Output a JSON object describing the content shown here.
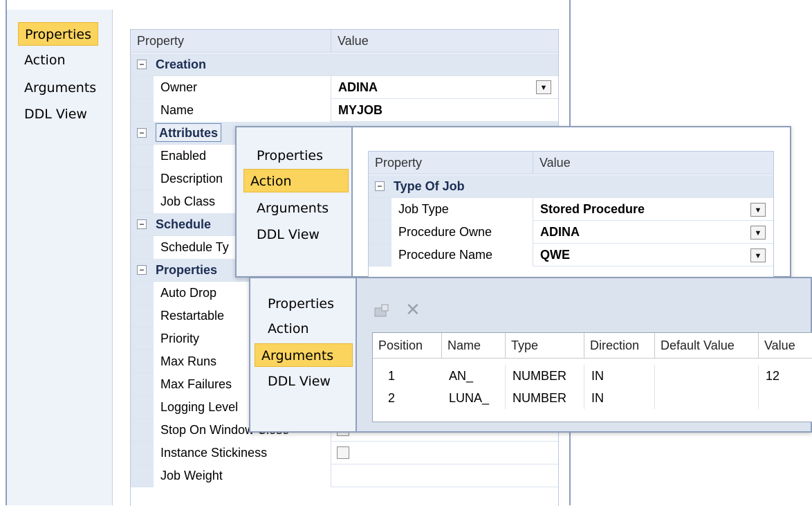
{
  "side_tabs": [
    "Properties",
    "Action",
    "Arguments",
    "DDL View"
  ],
  "main": {
    "header": {
      "property": "Property",
      "value": "Value"
    },
    "categories": {
      "creation": "Creation",
      "attributes": "Attributes",
      "schedule": "Schedule",
      "properties": "Properties"
    },
    "owner": {
      "label": "Owner",
      "value": "ADINA"
    },
    "name": {
      "label": "Name",
      "value": "MYJOB"
    },
    "enabled": "Enabled",
    "description": "Description",
    "job_class": "Job Class",
    "schedule_type": "Schedule Ty",
    "auto_drop": "Auto Drop",
    "restartable": "Restartable",
    "priority": "Priority",
    "max_runs": "Max Runs",
    "max_failures": "Max Failures",
    "logging_level": "Logging Level",
    "stop_on_window_close": "Stop On Window Close",
    "instance_stickiness": "Instance Stickiness",
    "job_weight": "Job Weight"
  },
  "action": {
    "header": {
      "property": "Property",
      "value": "Value"
    },
    "category": "Type Of Job",
    "rows": [
      {
        "label": "Job Type",
        "value": "Stored Procedure"
      },
      {
        "label": "Procedure Owne",
        "value": "ADINA"
      },
      {
        "label": "Procedure Name",
        "value": "QWE"
      }
    ]
  },
  "arguments": {
    "toolbar": {
      "add_icon": "add-argument-icon",
      "delete_icon": "delete-icon"
    },
    "columns": [
      "Position",
      "Name",
      "Type",
      "Direction",
      "Default Value",
      "Value"
    ],
    "rows": [
      [
        "1",
        "AN_",
        "NUMBER",
        "IN",
        "",
        "12"
      ],
      [
        "2",
        "LUNA_",
        "NUMBER",
        "IN",
        "",
        ""
      ]
    ]
  },
  "colors": {
    "active_tab": "#fbd45e",
    "sidebar": "#eef2f9",
    "category_bg": "#dfe7f3",
    "header_bg": "#e3eaf6"
  }
}
